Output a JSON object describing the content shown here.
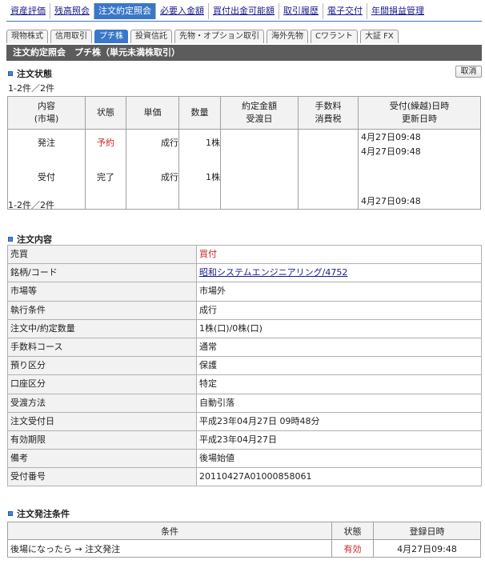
{
  "nav": {
    "tabs": [
      "資産評価",
      "残高照会",
      "注文約定照会",
      "必要入金額",
      "買付出金可能額",
      "取引履歴",
      "電子交付",
      "年間損益管理"
    ],
    "active_index": 2
  },
  "subnav": {
    "tabs": [
      "現物株式",
      "信用取引",
      "プチ株",
      "投資信託",
      "先物・オプション取引",
      "海外先物",
      "Cワラント",
      "大証 FX"
    ],
    "active_index": 2
  },
  "title": "注文約定照会　プチ株（単元未満株取引）",
  "status_section": {
    "heading": "注文状態",
    "cancel_label": "取消",
    "count_top": "1-2件／2件",
    "count_bottom": "1-2件／2件",
    "headers": {
      "content": "内容",
      "content_sub": "(市場)",
      "state": "状態",
      "price": "単価",
      "qty": "数量",
      "amount": "約定金額",
      "amount_sub": "受渡日",
      "fee": "手数料",
      "fee_sub": "消費税",
      "received": "受付(繰越)日時",
      "received_sub": "更新日時"
    },
    "rows": [
      {
        "content": "発注",
        "state": "予約",
        "price": "成行",
        "qty": "1株",
        "date1": "4月27日09:48",
        "date2": "4月27日09:48"
      },
      {
        "content": "受付",
        "state": "完了",
        "price": "成行",
        "qty": "1株",
        "date1": "",
        "date2": "4月27日09:48"
      }
    ]
  },
  "detail_section": {
    "heading": "注文内容",
    "rows": [
      {
        "label": "売買",
        "value": "買付"
      },
      {
        "label": "銘柄/コード",
        "value": "昭和システムエンジニアリング/4752"
      },
      {
        "label": "市場等",
        "value": "市場外"
      },
      {
        "label": "執行条件",
        "value": "成行"
      },
      {
        "label": "注文中/約定数量",
        "value": "1株(口)/0株(口)"
      },
      {
        "label": "手数料コース",
        "value": "通常"
      },
      {
        "label": "預り区分",
        "value": "保護"
      },
      {
        "label": "口座区分",
        "value": "特定"
      },
      {
        "label": "受渡方法",
        "value": "自動引落"
      },
      {
        "label": "注文受付日",
        "value": "平成23年04月27日 09時48分"
      },
      {
        "label": "有効期限",
        "value": "平成23年04月27日"
      },
      {
        "label": "備考",
        "value": "後場始値"
      },
      {
        "label": "受付番号",
        "value": "20110427A01000858061"
      }
    ]
  },
  "condition_section": {
    "heading": "注文発注条件",
    "headers": {
      "condition": "条件",
      "state": "状態",
      "date": "登録日時"
    },
    "row": {
      "condition": "後場になったら → 注文発注",
      "state": "有効",
      "date": "4月27日09:48"
    }
  },
  "colors": {
    "accent": "#3a77c8",
    "title_bar": "#5c5c5c",
    "status_red": "#cc2222",
    "link": "#1a1a8c"
  }
}
